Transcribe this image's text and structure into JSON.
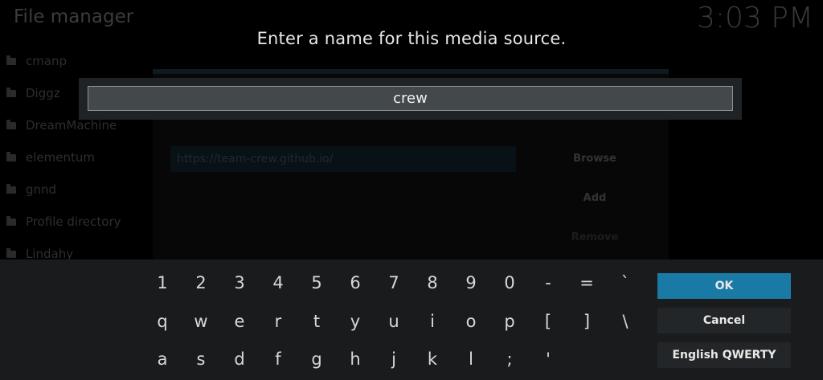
{
  "window": {
    "title": "File manager",
    "clock": "3:03 PM"
  },
  "sidebar": {
    "items": [
      {
        "label": "cmanp"
      },
      {
        "label": "Diggz"
      },
      {
        "label": "DreamMachine"
      },
      {
        "label": "elementum"
      },
      {
        "label": "gnnd"
      },
      {
        "label": "Profile directory"
      },
      {
        "label": "Lindahy"
      }
    ]
  },
  "source_dialog": {
    "url": "https://team-crew.github.io/",
    "browse_label": "Browse",
    "add_label": "Add",
    "remove_label": "Remove"
  },
  "prompt": {
    "heading": "Enter a name for this media source.",
    "input_value": "crew"
  },
  "keyboard": {
    "rows": [
      [
        "1",
        "2",
        "3",
        "4",
        "5",
        "6",
        "7",
        "8",
        "9",
        "0",
        "-",
        "=",
        "`"
      ],
      [
        "q",
        "w",
        "e",
        "r",
        "t",
        "y",
        "u",
        "i",
        "o",
        "p",
        "[",
        "]",
        "\\"
      ],
      [
        "a",
        "s",
        "d",
        "f",
        "g",
        "h",
        "j",
        "k",
        "l",
        ";",
        "'"
      ]
    ],
    "ok_label": "OK",
    "cancel_label": "Cancel",
    "layout_label": "English QWERTY",
    "accent_color": "#1a7aa6"
  }
}
